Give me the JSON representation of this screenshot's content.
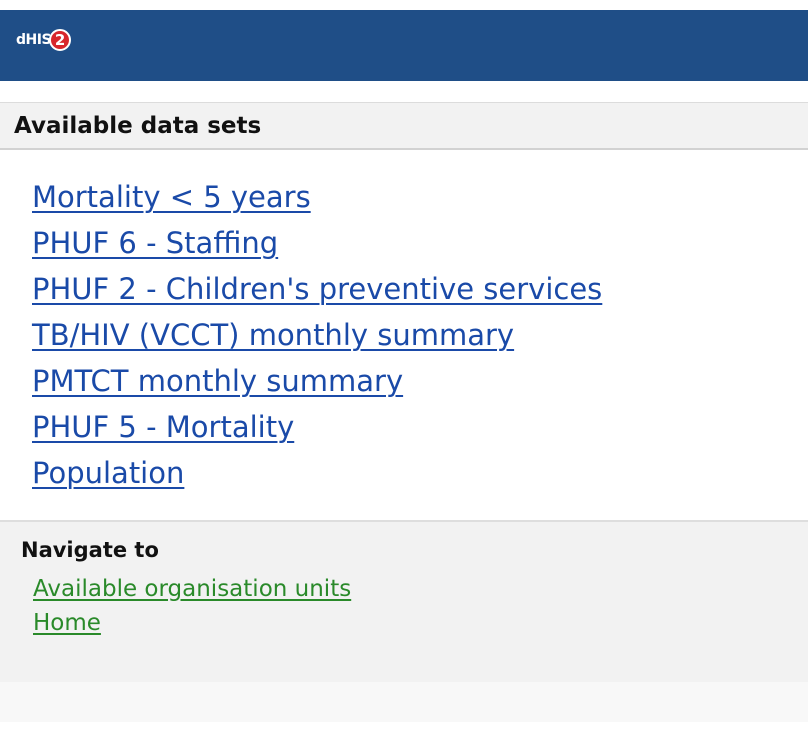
{
  "header": {
    "logo_text": "dHIS",
    "logo_badge": "2"
  },
  "datasets": {
    "title": "Available data sets",
    "items": [
      "Mortality < 5 years",
      "PHUF 6 - Staffing",
      "PHUF 2 - Children's preventive services",
      "TB/HIV (VCCT) monthly summary",
      "PMTCT monthly summary",
      "PHUF 5 - Mortality",
      "Population"
    ]
  },
  "navigation": {
    "title": "Navigate to",
    "items": [
      "Available organisation units",
      "Home"
    ]
  },
  "colors": {
    "header_bg": "#1f4e87",
    "dataset_link": "#1a4aa8",
    "nav_link": "#2a8a2a",
    "logo_badge": "#d7262c"
  },
  "icons": {
    "logo": "dhis2-logo"
  }
}
